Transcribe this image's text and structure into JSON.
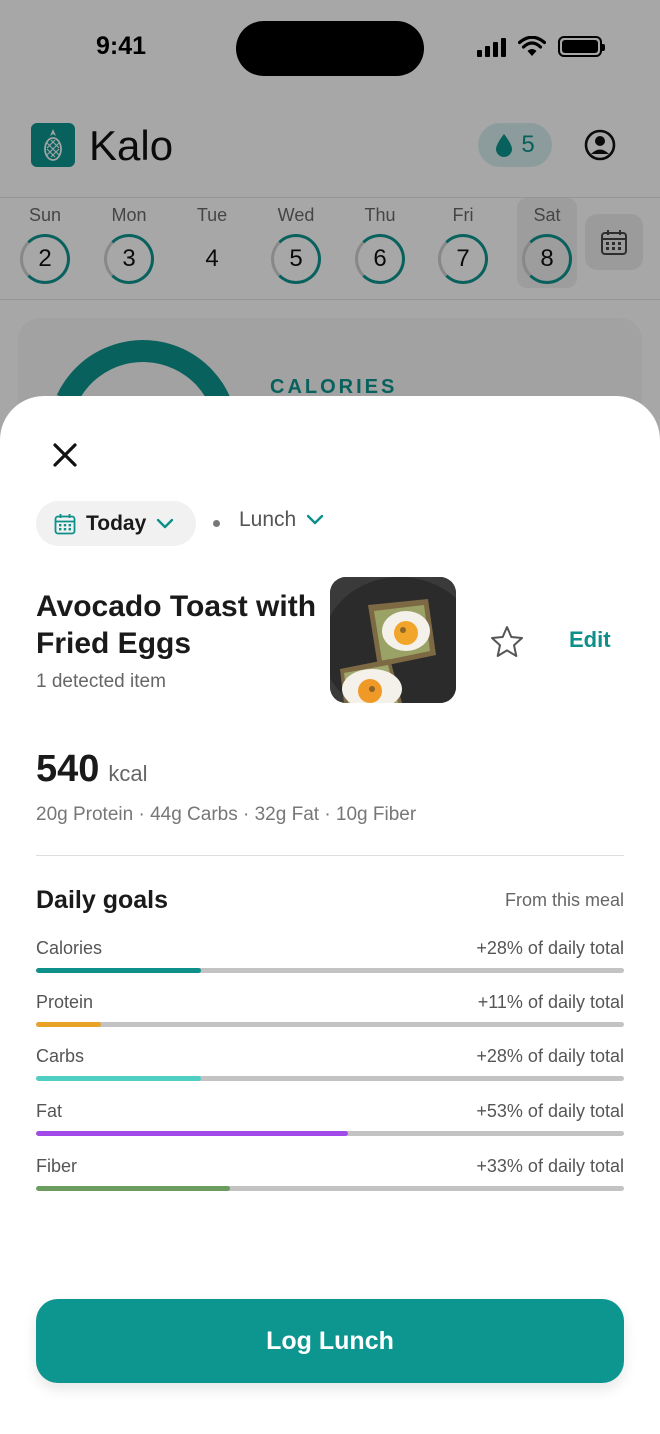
{
  "status_bar": {
    "time": "9:41"
  },
  "header": {
    "app_name": "Kalo",
    "water_count": "5",
    "logo_icon": "pineapple-icon",
    "water_icon": "water-drop-icon",
    "profile_icon": "user-circle-icon"
  },
  "week": {
    "days": [
      {
        "name": "Sun",
        "date": "2"
      },
      {
        "name": "Mon",
        "date": "3"
      },
      {
        "name": "Tue",
        "date": "4"
      },
      {
        "name": "Wed",
        "date": "5"
      },
      {
        "name": "Thu",
        "date": "6"
      },
      {
        "name": "Fri",
        "date": "7"
      },
      {
        "name": "Sat",
        "date": "8"
      }
    ],
    "selected": "Sat"
  },
  "summary": {
    "label": "CALORIES"
  },
  "sheet": {
    "date_label": "Today",
    "meal_label": "Lunch",
    "food_title": "Avocado Toast with Fried Eggs",
    "food_subtitle": "1 detected item",
    "edit_label": "Edit",
    "kcal_value": "540",
    "kcal_unit": "kcal",
    "macros": "20g Protein · 44g Carbs · 32g Fat · 10g Fiber",
    "goals_title": "Daily goals",
    "goals_meta": "From this meal",
    "goals": [
      {
        "label": "Calories",
        "value": "+28% of daily total",
        "fraction": 0.28,
        "color": "#0d8f8a"
      },
      {
        "label": "Protein",
        "value": "+11% of daily total",
        "fraction": 0.11,
        "color": "#e8a227"
      },
      {
        "label": "Carbs",
        "value": "+28% of daily total",
        "fraction": 0.28,
        "color": "#4fcfc4"
      },
      {
        "label": "Fat",
        "value": "+53% of daily total",
        "fraction": 0.53,
        "color": "#a24ae8"
      },
      {
        "label": "Fiber",
        "value": "+33% of daily total",
        "fraction": 0.33,
        "color": "#6a9d5f"
      }
    ],
    "log_button": "Log Lunch"
  },
  "colors": {
    "accent": "#0d8f8a",
    "button": "#0d9590"
  }
}
